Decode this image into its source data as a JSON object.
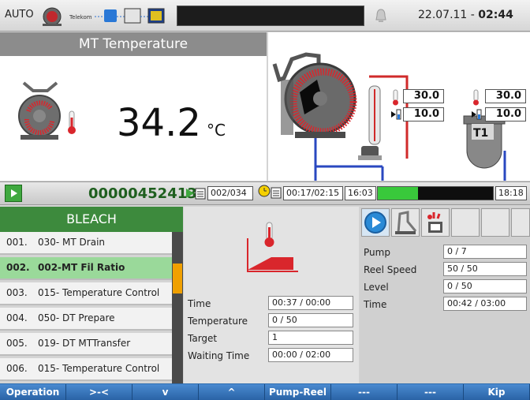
{
  "topbar": {
    "mode": "AUTO",
    "date": "22.07.11",
    "date_sep": " - ",
    "time": "02:44",
    "logo_text": "Telekom"
  },
  "header": {
    "title": "MT Temperature",
    "temperature_value": "34.2",
    "temperature_unit": "°C"
  },
  "machine": {
    "sensor1_temp": "30.0",
    "sensor1_level": "10.0",
    "sensor2_temp": "30.0",
    "sensor2_level": "10.0",
    "tank_label": "T1"
  },
  "counter": {
    "batch_number": "00000452413",
    "step_counter": "002/034",
    "elapsed": "00:17/02:15",
    "start_time": "16:03",
    "end_time": "18:18",
    "progress_fraction": 0.35
  },
  "program": {
    "name": "BLEACH",
    "selected_index": 1,
    "steps": [
      {
        "num": "001.",
        "label": "030- MT Drain"
      },
      {
        "num": "002.",
        "label": "002-MT Fil Ratio"
      },
      {
        "num": "003.",
        "label": "015- Temperature Control"
      },
      {
        "num": "004.",
        "label": "050- DT Prepare"
      },
      {
        "num": "005.",
        "label": "019- DT MTTransfer"
      },
      {
        "num": "006.",
        "label": "015- Temperature Control"
      }
    ]
  },
  "step_params": {
    "time_label": "Time",
    "time_value": "00:37 / 00:00",
    "temp_label": "Temperature",
    "temp_value": "0 / 50",
    "target_label": "Target",
    "target_value": "1",
    "wait_label": "Waiting Time",
    "wait_value": "00:00 / 02:00"
  },
  "machine_params": {
    "pump_label": "Pump",
    "pump_value": "0 / 7",
    "reel_label": "Reel Speed",
    "reel_value": "50 / 50",
    "level_label": "Level",
    "level_value": "0 / 50",
    "time_label": "Time",
    "time_value": "00:42 / 03:00"
  },
  "menu": [
    "Operation",
    ">-<",
    "v",
    "^",
    "Pump-Reel",
    "---",
    "---",
    "Kip"
  ],
  "colors": {
    "accent_green": "#3d8a3d",
    "menu_blue": "#2f6db0",
    "progress_green": "#39c93b",
    "heat_red": "#d9262c"
  }
}
